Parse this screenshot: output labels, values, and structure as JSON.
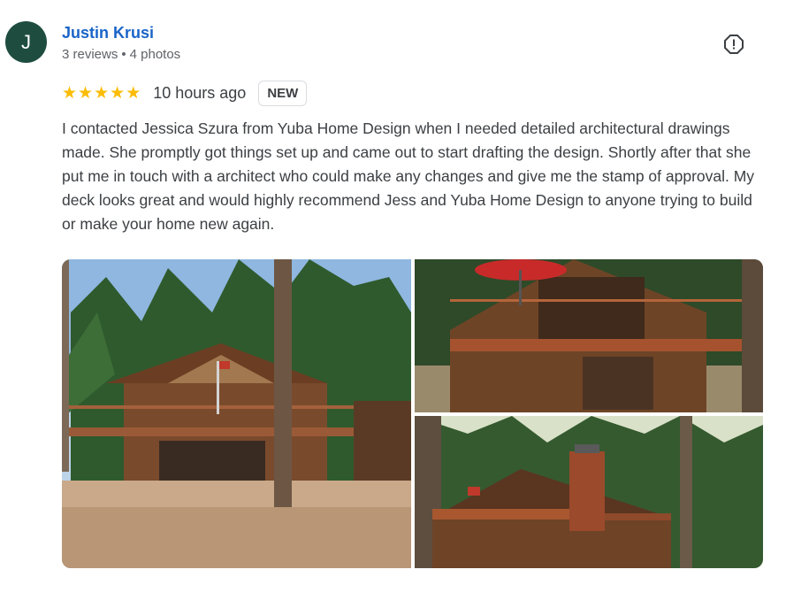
{
  "reviewer": {
    "initial": "J",
    "name": "Justin Krusi",
    "reviews": "3 reviews",
    "separator": "•",
    "photos": "4 photos"
  },
  "review": {
    "rating": 5,
    "time_ago": "10 hours ago",
    "badge": "NEW",
    "text": "I contacted Jessica Szura from Yuba Home Design when I needed detailed architectural drawings made. She promptly got things set up and came out to start drafting the design. Shortly after that she put me in touch with a architect who could make any changes and give me the stamp of approval. My deck looks great and would highly recommend Jess and Yuba Home Design to anyone trying to build or make your home new again."
  },
  "icons": {
    "report": "flag-alert-icon",
    "star": "star-icon"
  },
  "colors": {
    "avatar_bg": "#1e4d40",
    "name_link": "#1a64c8",
    "star": "#fbbc04",
    "text": "#3c4043",
    "meta": "#5f6368"
  }
}
